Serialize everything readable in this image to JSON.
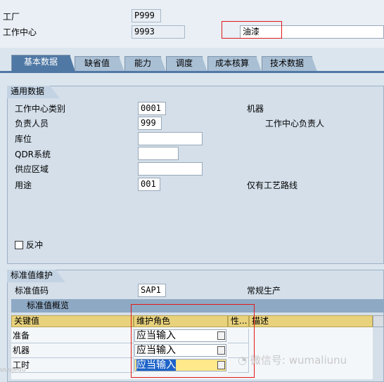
{
  "header": {
    "plant_label": "工厂",
    "plant_value": "P999",
    "workcenter_label": "工作中心",
    "workcenter_value": "9993",
    "workcenter_desc": "油漆"
  },
  "tabs": [
    {
      "label": "基本数据"
    },
    {
      "label": "缺省值"
    },
    {
      "label": "能力"
    },
    {
      "label": "调度"
    },
    {
      "label": "成本核算"
    },
    {
      "label": "技术数据"
    }
  ],
  "general": {
    "title": "通用数据",
    "category_label": "工作中心类别",
    "category_value": "0001",
    "category_desc": "机器",
    "person_label": "负责人员",
    "person_value": "999",
    "person_desc": "工作中心负责人",
    "location_label": "库位",
    "location_value": "",
    "qdr_label": "QDR系统",
    "qdr_value": "",
    "supply_label": "供应区域",
    "supply_value": "",
    "usage_label": "用途",
    "usage_value": "001",
    "usage_desc": "仅有工艺路线",
    "backflush_label": "反冲"
  },
  "standard": {
    "title": "标准值维护",
    "key_label": "标准值码",
    "key_value": "SAP1",
    "key_desc": "常规生产",
    "overview_title": "标准值概览",
    "columns": [
      "关键值",
      "维护角色",
      "性...",
      "描述"
    ],
    "rows": [
      {
        "key": "准备",
        "role": "应当输入"
      },
      {
        "key": "机器",
        "role": "应当输入"
      },
      {
        "key": "工时",
        "role": "应当输入"
      }
    ]
  },
  "watermark": {
    "text": "微信号: wumaliunu",
    "small": "uuujeuu"
  },
  "colors": {
    "active_tab": "#4f78a4",
    "highlight_box": "#e01818",
    "table_header": "#e8d27c"
  }
}
